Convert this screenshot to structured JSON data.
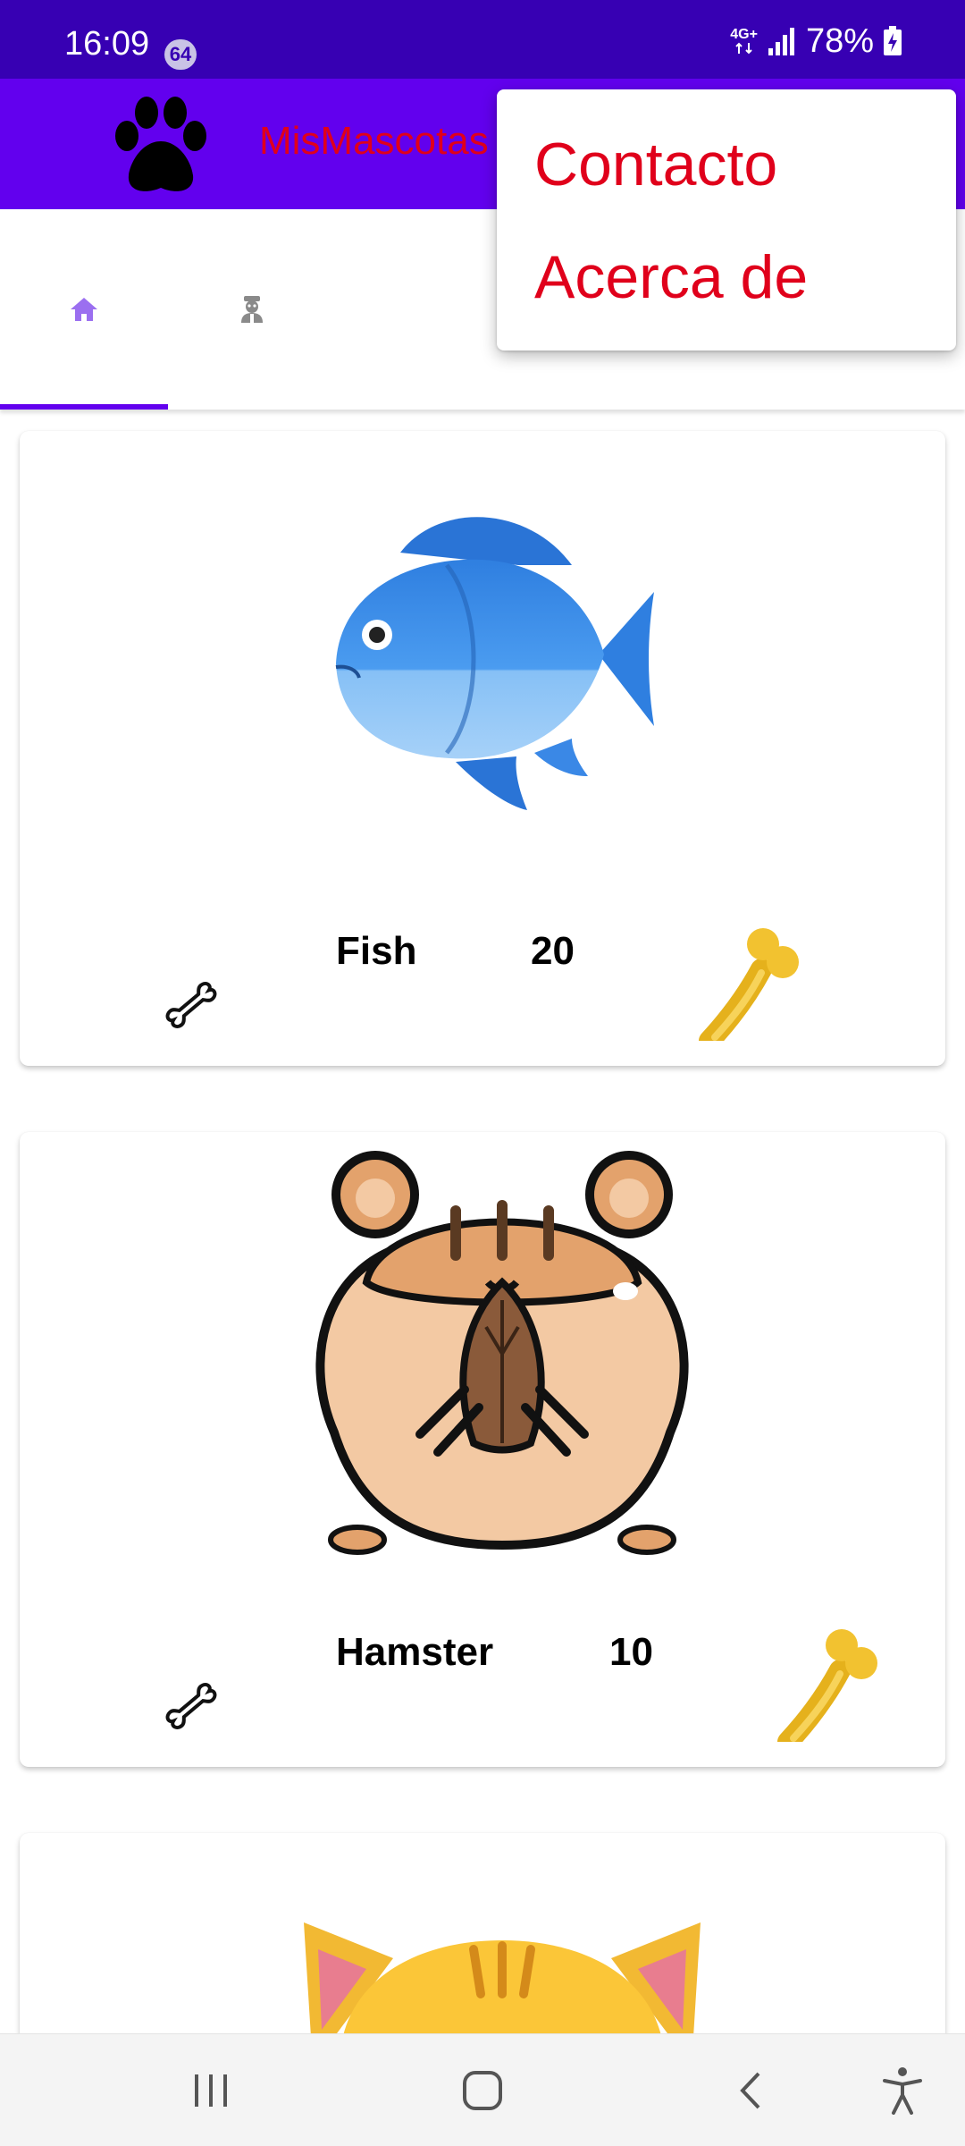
{
  "status_bar": {
    "time": "16:09",
    "notification_count": "64",
    "network_type": "4G+",
    "battery": "78%"
  },
  "app_bar": {
    "title": "MisMascotas",
    "logo_icon": "paw-icon"
  },
  "tabs": [
    {
      "icon": "home-icon",
      "selected": true
    },
    {
      "icon": "pet-profile-icon",
      "selected": false
    }
  ],
  "overflow_menu": {
    "items": [
      {
        "label": "Contacto"
      },
      {
        "label": "Acerca de"
      }
    ]
  },
  "pets": [
    {
      "name": "Fish",
      "rating": "20",
      "image": "fish-image"
    },
    {
      "name": "Hamster",
      "rating": "10",
      "image": "hamster-image"
    },
    {
      "image": "cat-image"
    }
  ],
  "nav_bar": {
    "buttons": [
      "recents-icon",
      "home-icon",
      "back-icon",
      "accessibility-icon"
    ]
  },
  "colors": {
    "status_bar": "#3700B3",
    "app_bar": "#6200EE",
    "title_red": "#e0001b",
    "tab_active": "#9b6ff0",
    "bone_gold": "#f2c230"
  }
}
